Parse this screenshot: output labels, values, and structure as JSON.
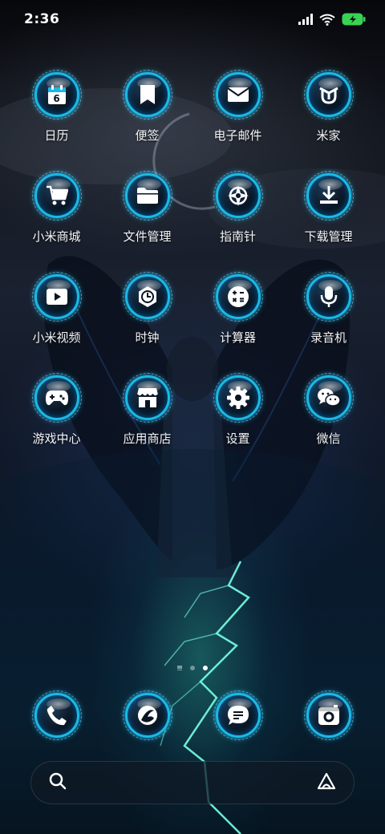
{
  "status_bar": {
    "time": "2:36",
    "battery_color": "#39d353"
  },
  "apps": [
    {
      "label": "日历",
      "icon": "calendar-icon",
      "badge": "6"
    },
    {
      "label": "便签",
      "icon": "notes-icon"
    },
    {
      "label": "电子邮件",
      "icon": "mail-icon"
    },
    {
      "label": "米家",
      "icon": "mi-home-icon"
    },
    {
      "label": "小米商城",
      "icon": "shopping-cart-icon"
    },
    {
      "label": "文件管理",
      "icon": "folder-icon"
    },
    {
      "label": "指南针",
      "icon": "compass-icon"
    },
    {
      "label": "下载管理",
      "icon": "download-icon"
    },
    {
      "label": "小米视频",
      "icon": "video-play-icon"
    },
    {
      "label": "时钟",
      "icon": "clock-icon"
    },
    {
      "label": "计算器",
      "icon": "calculator-icon"
    },
    {
      "label": "录音机",
      "icon": "microphone-icon"
    },
    {
      "label": "游戏中心",
      "icon": "gamepad-icon"
    },
    {
      "label": "应用商店",
      "icon": "store-icon"
    },
    {
      "label": "设置",
      "icon": "gear-icon"
    },
    {
      "label": "微信",
      "icon": "wechat-icon"
    }
  ],
  "dock": [
    {
      "icon": "phone-icon"
    },
    {
      "icon": "browser-icon"
    },
    {
      "icon": "messages-icon"
    },
    {
      "icon": "camera-icon"
    }
  ],
  "page_indicator": {
    "pages": 3,
    "active": 3
  },
  "search": {
    "left_icon": "search-icon",
    "right_icon": "assistant-icon"
  },
  "accent_color": "#1bb9e6"
}
